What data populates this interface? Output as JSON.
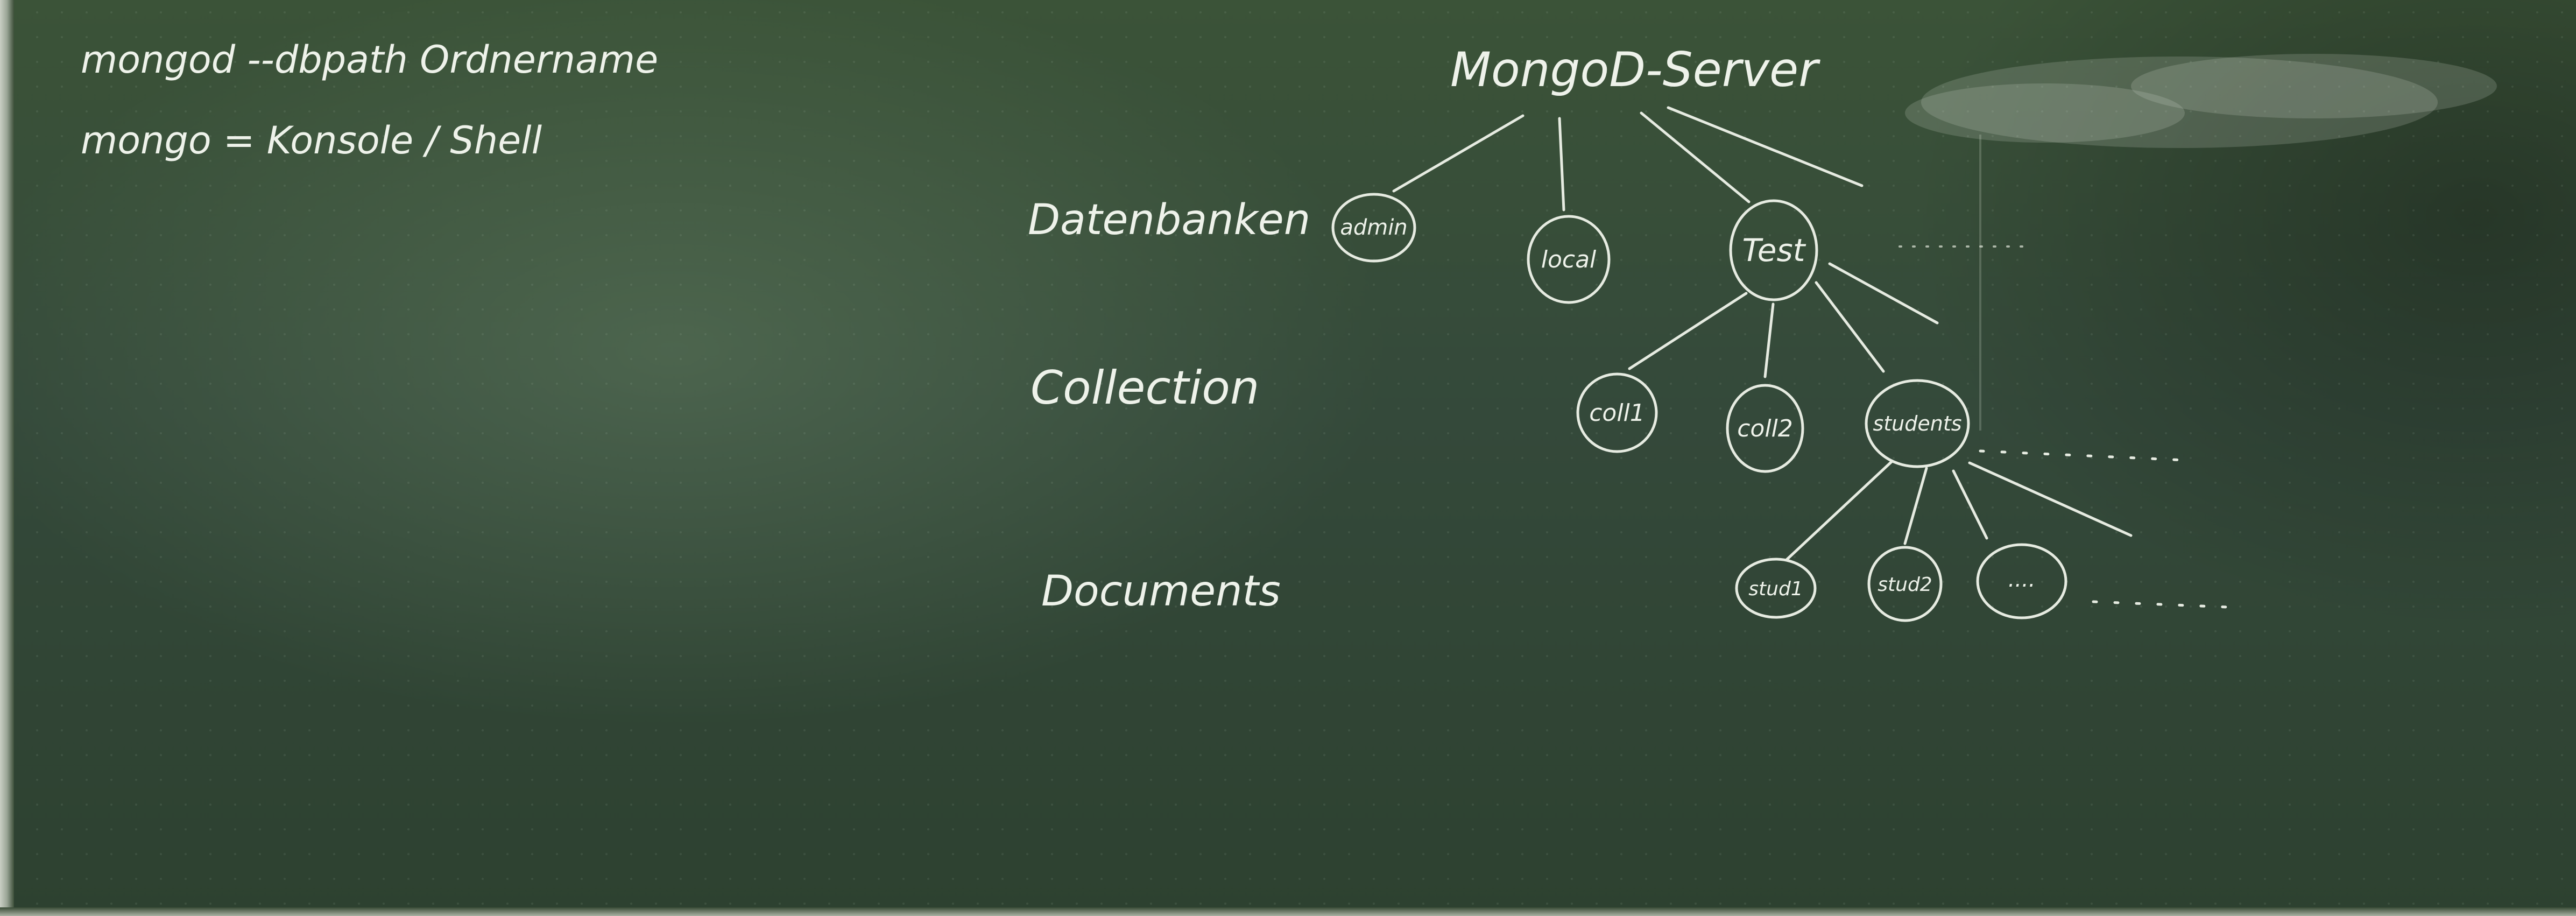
{
  "commands": {
    "line1": "mongod   --dbpath Ordnername",
    "line2": "mongo   = Konsole / Shell"
  },
  "levels": {
    "databases": "Datenbanken",
    "collection": "Collection",
    "documents": "Documents"
  },
  "tree": {
    "root": "MongoD-Server",
    "databases": [
      "admin",
      "local",
      "Test"
    ],
    "collections": [
      "coll1",
      "coll2",
      "students"
    ],
    "documents": [
      "stud1",
      "stud2",
      "...."
    ]
  },
  "colors": {
    "board": "#34493a",
    "chalk": "#eef2ea"
  }
}
